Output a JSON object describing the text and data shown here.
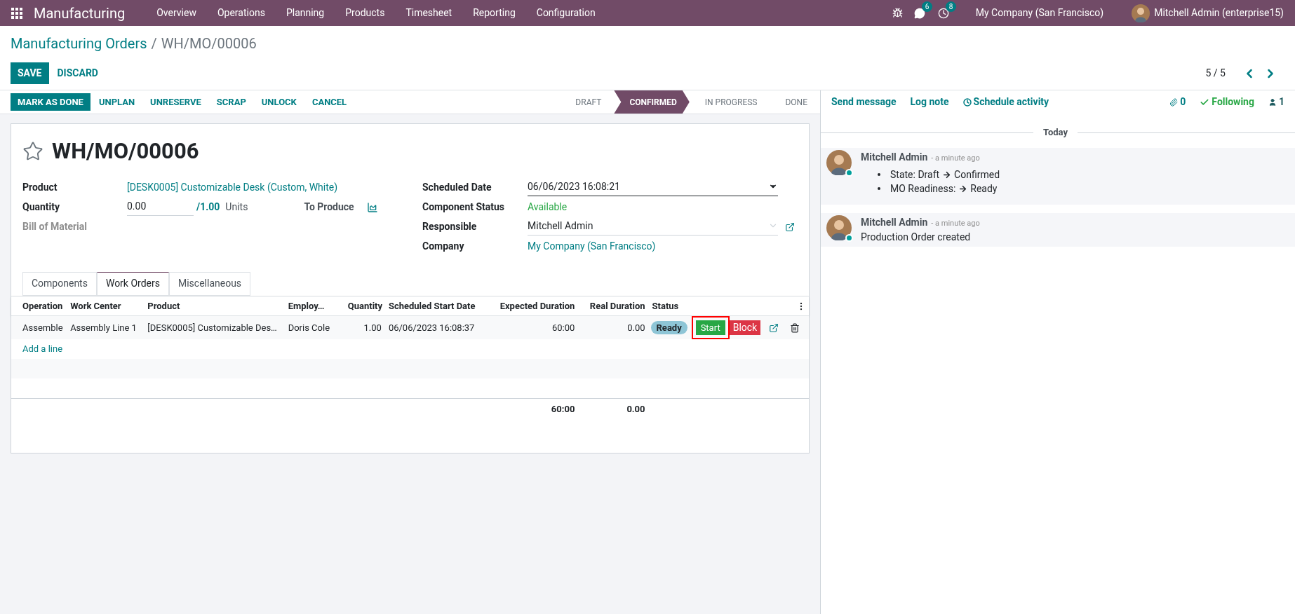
{
  "navbar": {
    "app": "Manufacturing",
    "menu": [
      "Overview",
      "Operations",
      "Planning",
      "Products",
      "Timesheet",
      "Reporting",
      "Configuration"
    ],
    "messages_count": "6",
    "activities_count": "8",
    "company": "My Company (San Francisco)",
    "user": "Mitchell Admin (enterprise15)"
  },
  "breadcrumb": {
    "parent": "Manufacturing Orders",
    "separator": "/",
    "current": "WH/MO/00006"
  },
  "buttons": {
    "save": "SAVE",
    "discard": "DISCARD"
  },
  "pager": "5 / 5",
  "actions": [
    {
      "label": "MARK AS DONE",
      "primary": true
    },
    {
      "label": "UNPLAN",
      "primary": false
    },
    {
      "label": "UNRESERVE",
      "primary": false
    },
    {
      "label": "SCRAP",
      "primary": false
    },
    {
      "label": "UNLOCK",
      "primary": false
    },
    {
      "label": "CANCEL",
      "primary": false
    }
  ],
  "stages": [
    {
      "label": "DRAFT",
      "selected": false
    },
    {
      "label": "CONFIRMED",
      "selected": true
    },
    {
      "label": "IN PROGRESS",
      "selected": false
    },
    {
      "label": "DONE",
      "selected": false
    }
  ],
  "record": {
    "favorite": false,
    "title": "WH/MO/00006"
  },
  "left_fields": {
    "product_label": "Product",
    "product": "[DESK0005] Customizable Desk (Custom, White)",
    "quantity_label": "Quantity",
    "quantity": "0.00",
    "quantity_total": "/1.00",
    "uom": "Units",
    "to_produce": "To Produce",
    "bom_label": "Bill of Material"
  },
  "right_fields": [
    {
      "label": "Scheduled Date",
      "value": "06/06/2023 16:08:21",
      "kind": "date"
    },
    {
      "label": "Component Status",
      "value": "Available",
      "kind": "status"
    },
    {
      "label": "Responsible",
      "value": "Mitchell Admin",
      "kind": "many2one"
    },
    {
      "label": "Company",
      "value": "My Company (San Francisco)",
      "kind": "link"
    }
  ],
  "tabs": [
    {
      "label": "Components",
      "selected": false
    },
    {
      "label": "Work Orders",
      "selected": true
    },
    {
      "label": "Miscellaneous",
      "selected": false
    }
  ],
  "table": {
    "columns": [
      "Operation",
      "Work Center",
      "Product",
      "Employ…",
      "Quantity",
      "Scheduled Start Date",
      "Expected Duration",
      "Real Duration",
      "Status"
    ],
    "rows": [
      {
        "operation": "Assemble",
        "work_center": "Assembly Line 1",
        "product": "[DESK0005] Customizable Des…",
        "employee": "Doris Cole",
        "quantity": "1.00",
        "start": "06/06/2023 16:08:37",
        "expected": "60:00",
        "real": "0.00",
        "status": "Ready",
        "start_button": "Start",
        "start_highlighted": true,
        "block_button": "Block"
      }
    ],
    "add_line": "Add a line",
    "total_expected": "60:00",
    "total_real": "0.00"
  },
  "chatter": {
    "send": "Send message",
    "log": "Log note",
    "schedule": "Schedule activity",
    "attachments": "0",
    "following": "Following",
    "followers": "1",
    "date_separator": "Today",
    "messages": [
      {
        "author": "Mitchell Admin",
        "time": "- a minute ago",
        "kind": "tracking",
        "lines": [
          {
            "field": "State: Draft",
            "value": "Confirmed"
          },
          {
            "field": "MO Readiness:",
            "value": "Ready"
          }
        ]
      },
      {
        "author": "Mitchell Admin",
        "time": "- a minute ago",
        "kind": "text",
        "body": "Production Order created"
      }
    ]
  }
}
